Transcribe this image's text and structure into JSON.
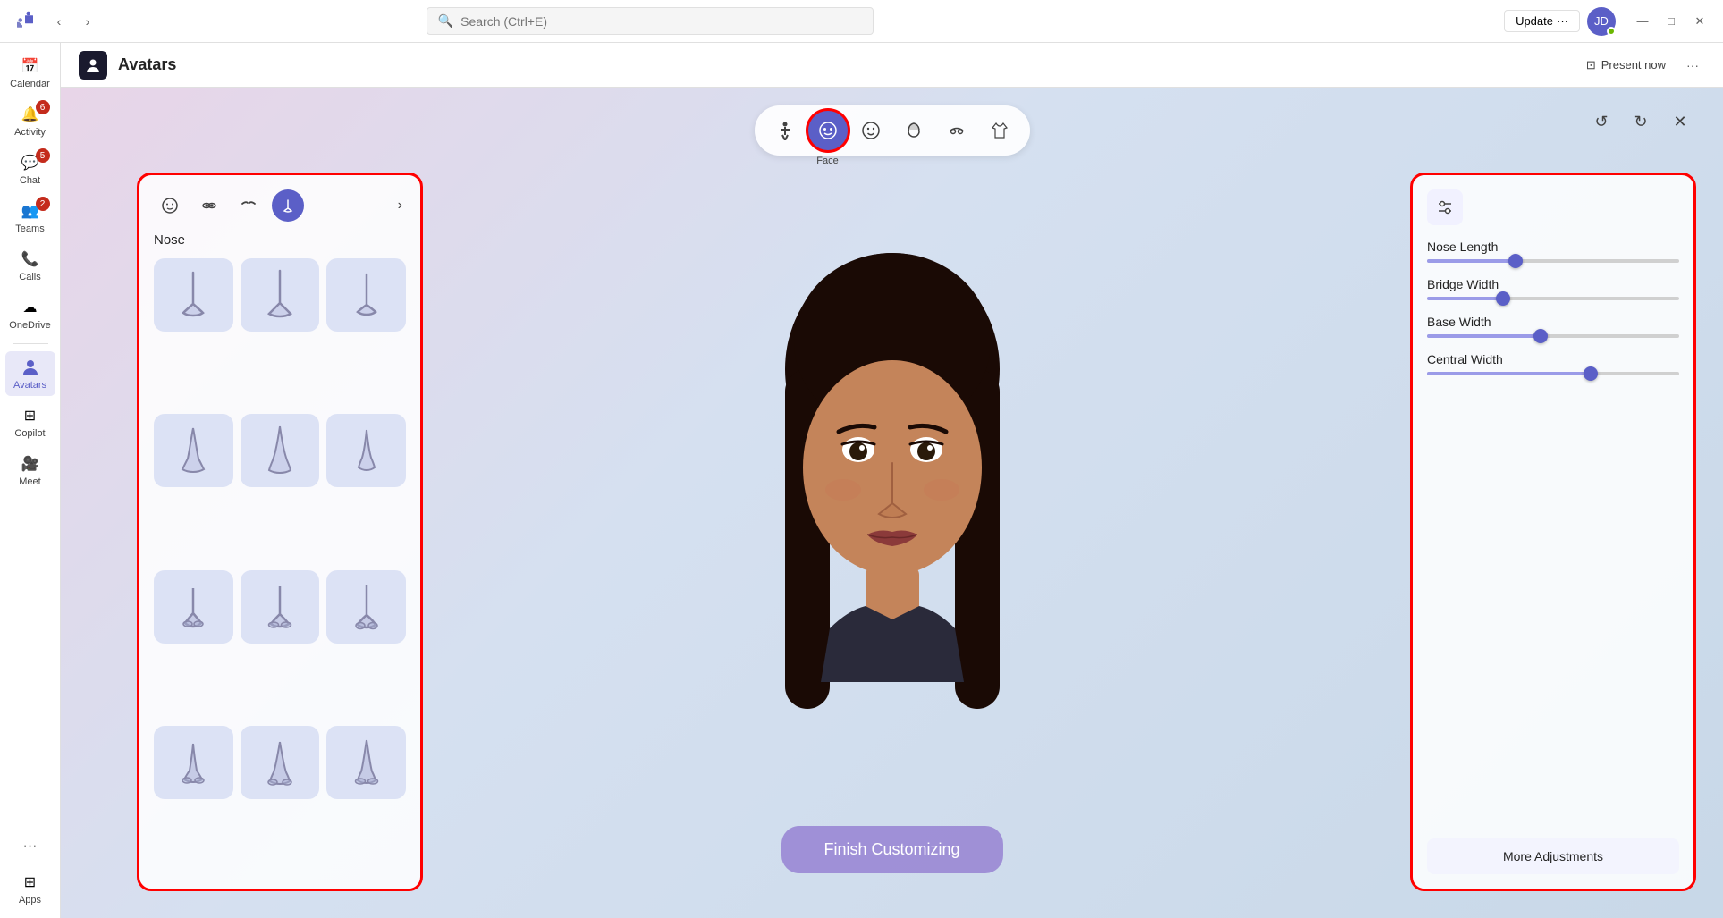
{
  "titlebar": {
    "search_placeholder": "Search (Ctrl+E)",
    "update_label": "Update",
    "update_dots": "···",
    "user_initials": "JD",
    "minimize": "—",
    "maximize": "□",
    "close": "✕"
  },
  "sidebar": {
    "items": [
      {
        "id": "calendar",
        "label": "Calendar",
        "icon": "📅",
        "badge": null,
        "active": false
      },
      {
        "id": "activity",
        "label": "Activity",
        "icon": "🔔",
        "badge": "6",
        "active": false
      },
      {
        "id": "chat",
        "label": "Chat",
        "icon": "💬",
        "badge": "5",
        "active": false
      },
      {
        "id": "teams",
        "label": "Teams",
        "icon": "👥",
        "badge": "2",
        "active": false
      },
      {
        "id": "calls",
        "label": "Calls",
        "icon": "📞",
        "badge": null,
        "active": false
      },
      {
        "id": "onedrive",
        "label": "OneDrive",
        "icon": "☁",
        "badge": null,
        "active": false
      },
      {
        "id": "avatars",
        "label": "Avatars",
        "icon": "👤",
        "badge": null,
        "active": true
      },
      {
        "id": "copilot",
        "label": "Copilot",
        "icon": "⊞",
        "badge": null,
        "active": false
      },
      {
        "id": "meet",
        "label": "Meet",
        "icon": "🎥",
        "badge": null,
        "active": false
      },
      {
        "id": "more",
        "label": "···",
        "icon": "···",
        "badge": null,
        "active": false
      },
      {
        "id": "apps",
        "label": "Apps",
        "icon": "⊞",
        "badge": null,
        "active": false
      }
    ]
  },
  "app": {
    "title": "Avatars",
    "present_now": "Present now",
    "more_options": "···"
  },
  "toolbar": {
    "tabs": [
      {
        "id": "body",
        "icon": "🧍",
        "label": "",
        "active": false
      },
      {
        "id": "face",
        "icon": "😐",
        "label": "Face",
        "active": true
      },
      {
        "id": "expressions",
        "icon": "😊",
        "label": "",
        "active": false
      },
      {
        "id": "hair",
        "icon": "👤",
        "label": "",
        "active": false
      },
      {
        "id": "accessories",
        "icon": "🎒",
        "label": "",
        "active": false
      },
      {
        "id": "clothing",
        "icon": "👕",
        "label": "",
        "active": false
      }
    ],
    "undo": "↺",
    "redo": "↻",
    "close": "✕"
  },
  "left_panel": {
    "face_tabs": [
      {
        "id": "face-shape",
        "icon": "😐",
        "active": false
      },
      {
        "id": "eyes",
        "icon": "👁",
        "active": false
      },
      {
        "id": "eyebrows",
        "icon": "〰",
        "active": false
      },
      {
        "id": "nose",
        "icon": "👃",
        "active": true
      },
      {
        "id": "next",
        "icon": "›",
        "active": false
      }
    ],
    "section_title": "Nose",
    "nose_items": [
      {
        "id": 1
      },
      {
        "id": 2
      },
      {
        "id": 3
      },
      {
        "id": 4
      },
      {
        "id": 5
      },
      {
        "id": 6
      },
      {
        "id": 7
      },
      {
        "id": 8
      },
      {
        "id": 9
      },
      {
        "id": 10
      },
      {
        "id": 11
      },
      {
        "id": 12
      }
    ]
  },
  "right_panel": {
    "adjust_icon": "⚙",
    "sliders": [
      {
        "id": "nose-length",
        "label": "Nose Length",
        "value": 35
      },
      {
        "id": "bridge-width",
        "label": "Bridge Width",
        "value": 30
      },
      {
        "id": "base-width",
        "label": "Base Width",
        "value": 45
      },
      {
        "id": "central-width",
        "label": "Central Width",
        "value": 65
      }
    ],
    "more_adjustments": "More Adjustments"
  },
  "finish_btn": "Finish Customizing",
  "colors": {
    "accent": "#5b5fc7",
    "red_border": "#ff0000",
    "finish_bg": "rgba(150,130,210,0.85)"
  }
}
